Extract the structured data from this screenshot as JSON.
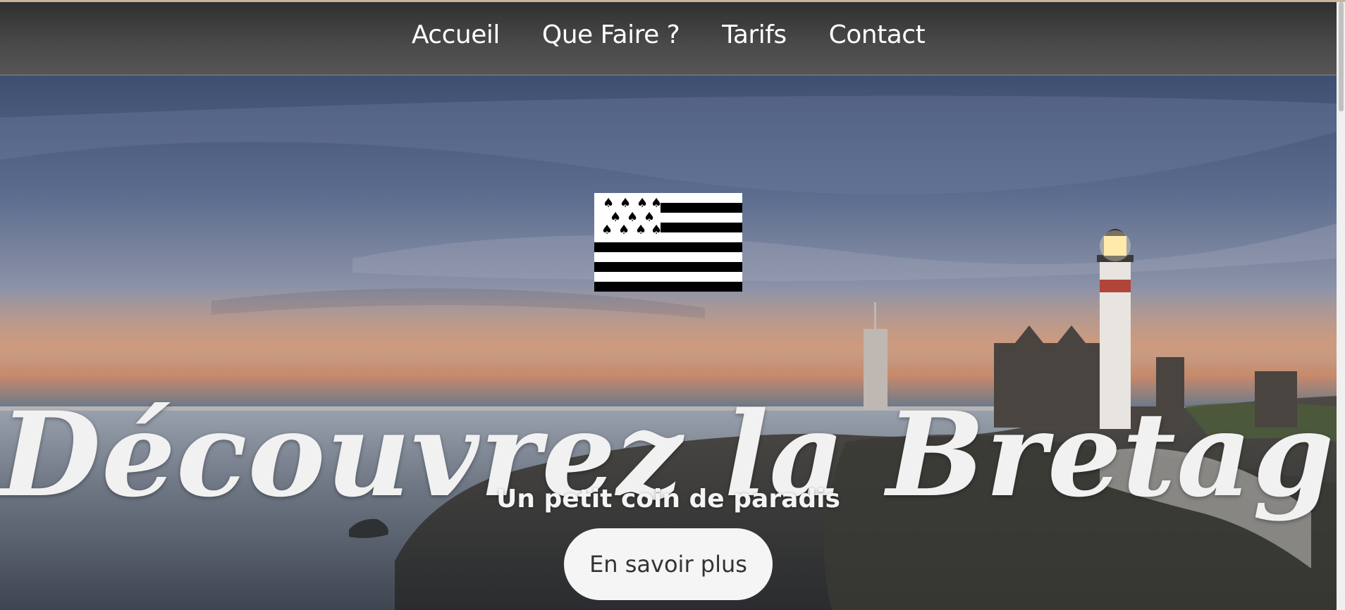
{
  "nav": {
    "items": [
      {
        "label": "Accueil"
      },
      {
        "label": "Que Faire ?"
      },
      {
        "label": "Tarifs"
      },
      {
        "label": "Contact"
      }
    ]
  },
  "hero": {
    "flag_icon": "breton-flag-gwenn-ha-du",
    "title": "Découvrez la Bretagne",
    "subtitle": "Un petit coin de paradis",
    "cta_label": "En savoir plus"
  },
  "colors": {
    "nav_background": "#4a4a4a",
    "nav_text": "#ffffff",
    "hero_title": "#f1f1f1",
    "cta_background": "#f5f5f5",
    "cta_text": "#333333"
  }
}
